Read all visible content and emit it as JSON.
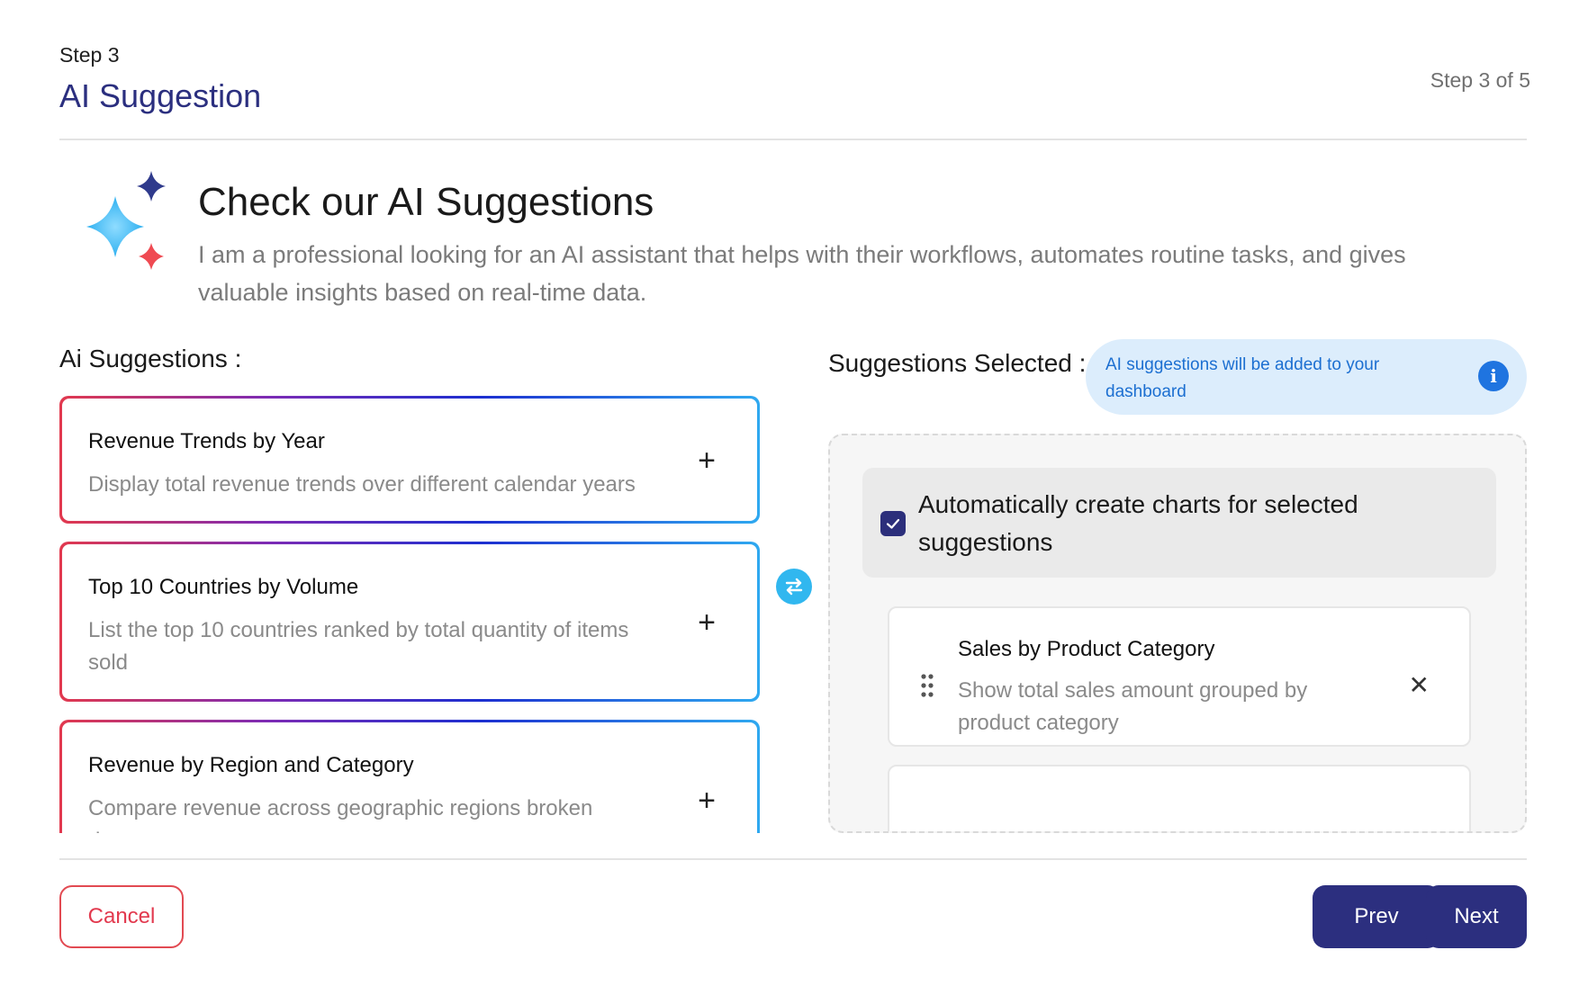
{
  "header": {
    "step_label": "Step 3",
    "title": "AI Suggestion",
    "step_counter": "Step 3 of 5"
  },
  "hero": {
    "title": "Check our AI Suggestions",
    "description": "I am a professional looking for an AI assistant that helps with their workflows, automates routine tasks, and gives valuable insights based on real-time data."
  },
  "suggestions": {
    "heading": "Ai Suggestions :",
    "items": [
      {
        "title": "Revenue Trends by Year",
        "description": "Display total revenue trends over different calendar years"
      },
      {
        "title": "Top 10 Countries by Volume",
        "description": "List the top 10 countries ranked by total quantity of items sold"
      },
      {
        "title": "Revenue by Region and Category",
        "description": "Compare revenue across geographic regions broken down"
      }
    ]
  },
  "selected": {
    "heading": "Suggestions Selected :",
    "info_text": "AI suggestions will be added to your dashboard",
    "auto_create_label": "Automatically create charts for selected suggestions",
    "auto_create_checked": true,
    "items": [
      {
        "title": "Sales by Product Category",
        "description": "Show total sales amount grouped by product category"
      }
    ]
  },
  "footer": {
    "cancel_label": "Cancel",
    "prev_label": "Prev",
    "next_label": "Next"
  },
  "colors": {
    "primary": "#2c2f7f",
    "danger": "#e2394e",
    "info_bg": "#dcedfc",
    "info_text": "#1c6fd1",
    "swap": "#31b7ef"
  }
}
